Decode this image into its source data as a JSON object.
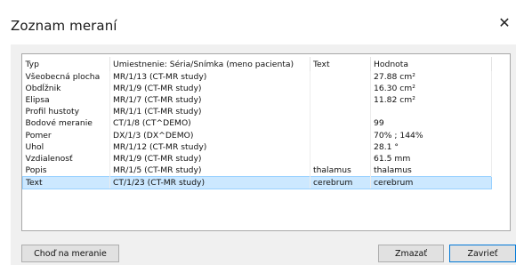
{
  "window": {
    "title": "Zoznam meraní",
    "close_glyph": "✕"
  },
  "table": {
    "headers": [
      "Typ",
      "Umiestnenie: Séria/Snímka (meno pacienta)",
      "Text",
      "Hodnota"
    ],
    "rows": [
      [
        "Všeobecná plocha",
        "MR/1/13  (CT-MR study)",
        "",
        "27.88 cm²"
      ],
      [
        "Obdĺžnik",
        "MR/1/9  (CT-MR study)",
        "",
        "16.30 cm²"
      ],
      [
        "Elipsa",
        "MR/1/7  (CT-MR study)",
        "",
        "11.82 cm²"
      ],
      [
        "Profil hustoty",
        "MR/1/1  (CT-MR study)",
        "",
        ""
      ],
      [
        "Bodové meranie",
        "CT/1/8  (CT^DEMO)",
        "",
        "99"
      ],
      [
        "Pomer",
        "DX/1/3  (DX^DEMO)",
        "",
        "70% ; 144%"
      ],
      [
        "Uhol",
        "MR/1/12  (CT-MR study)",
        "",
        "28.1 °"
      ],
      [
        "Vzdialenosť",
        "MR/1/9  (CT-MR study)",
        "",
        "61.5 mm"
      ],
      [
        "Popis",
        "MR/1/5  (CT-MR study)",
        "thalamus",
        "thalamus"
      ],
      [
        "Text",
        "CT/1/23  (CT-MR study)",
        "cerebrum",
        "cerebrum"
      ]
    ],
    "selected_row_index": 9
  },
  "buttons": {
    "go_to": "Choď na meranie",
    "delete": "Zmazať",
    "close": "Zavrieť"
  },
  "colors": {
    "selection_bg": "#cce8ff",
    "selection_border": "#99d1ff",
    "primary_border": "#0078d7"
  }
}
